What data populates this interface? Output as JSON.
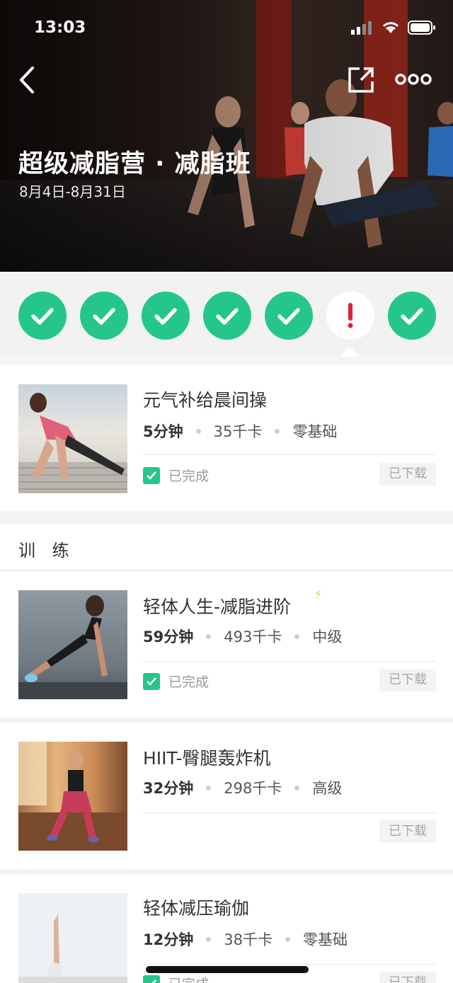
{
  "status_bar": {
    "time": "13:03"
  },
  "header": {
    "title": "超级减脂营 · 减脂班",
    "date_range": "8月4日-8月31日",
    "icons": [
      "back-icon",
      "share-icon",
      "more-icon"
    ]
  },
  "tracker": {
    "days": [
      {
        "state": "done"
      },
      {
        "state": "done"
      },
      {
        "state": "done"
      },
      {
        "state": "done"
      },
      {
        "state": "done"
      },
      {
        "state": "missed"
      },
      {
        "state": "done"
      }
    ],
    "colors": {
      "done": "#24c789",
      "missed": "#e0203a"
    }
  },
  "warmup": {
    "title": "元气补给晨间操",
    "duration": "5分钟",
    "calories": "35千卡",
    "level": "零基础",
    "status": "已完成",
    "download": "已下载"
  },
  "training": {
    "section_title": "训 练",
    "items": [
      {
        "title": "轻体人生-减脂进阶",
        "duration": "59分钟",
        "calories": "493千卡",
        "level": "中级",
        "status": "已完成",
        "download": "已下载",
        "badge": "⚡"
      },
      {
        "title": "HIIT-臀腿轰炸机",
        "duration": "32分钟",
        "calories": "298千卡",
        "level": "高级",
        "status": "",
        "download": "已下载"
      },
      {
        "title": "轻体减压瑜伽",
        "duration": "12分钟",
        "calories": "38千卡",
        "level": "零基础",
        "status": "已完成",
        "download": "已下载"
      }
    ]
  }
}
